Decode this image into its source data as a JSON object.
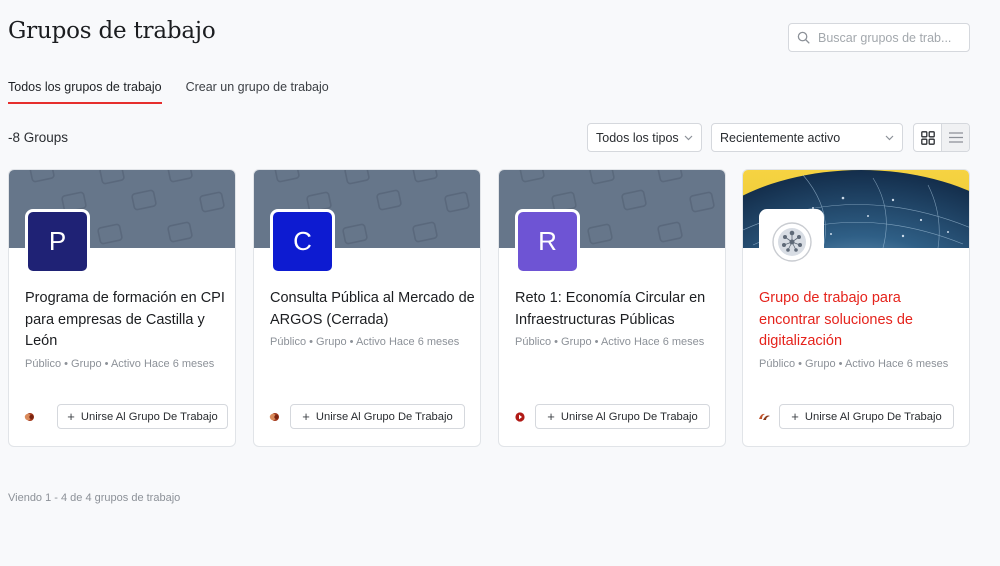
{
  "header": {
    "title": "Grupos de trabajo",
    "search_placeholder": "Buscar grupos de trab..."
  },
  "tabs": [
    {
      "label": "Todos los grupos de trabajo",
      "active": true
    },
    {
      "label": "Crear un grupo de trabajo",
      "active": false
    }
  ],
  "toolbar": {
    "count": "-8 Groups",
    "type_filter": "Todos los tipos",
    "sort_filter": "Recientemente activo"
  },
  "cards": [
    {
      "initial": "P",
      "avatar_color": "#1f2275",
      "title": "Programa de formación en CPI para empresas de Castilla y León",
      "meta": "Público • Grupo • Activo Hace 6 meses",
      "join_label": "Unirse Al Grupo De Trabajo",
      "title_color": "default"
    },
    {
      "initial": "C",
      "avatar_color": "#0d1bd1",
      "title": "Consulta Pública al Mercado de ARGOS (Cerrada)",
      "meta": "Público • Grupo • Activo Hace 6 meses",
      "join_label": "Unirse Al Grupo De Trabajo",
      "title_color": "default"
    },
    {
      "initial": "R",
      "avatar_color": "#6e54d4",
      "title": "Reto 1: Economía Circular en Infraestructuras Públicas",
      "meta": "Público • Grupo • Activo Hace 6 meses",
      "join_label": "Unirse Al Grupo De Trabajo",
      "title_color": "default"
    },
    {
      "initial": "",
      "avatar_color": "#ffffff",
      "title": "Grupo de trabajo para encontrar soluciones de digitalización",
      "meta": "Público • Grupo • Activo Hace 6 meses",
      "join_label": "Unirse Al Grupo De Trabajo",
      "title_color": "#e5231c"
    }
  ],
  "footer": {
    "pagination": "Viendo 1 - 4 de 4 grupos de trabajo"
  },
  "colors": {
    "accent": "#e62e2d",
    "cover_pattern": "#66768a"
  }
}
